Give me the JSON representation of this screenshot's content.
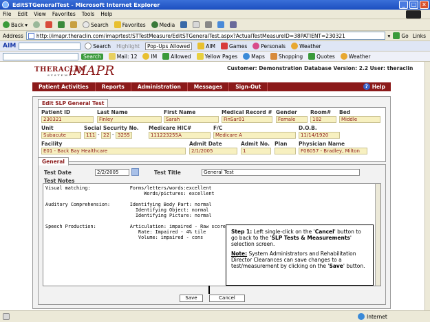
{
  "window": {
    "title": "EditSTGeneralTest - Microsoft Internet Explorer"
  },
  "menu": [
    "File",
    "Edit",
    "View",
    "Favorites",
    "Tools",
    "Help"
  ],
  "toolbar": {
    "back": "Back",
    "search": "Search",
    "favorites": "Favorites",
    "media": "Media",
    "links": "Links"
  },
  "address": {
    "label": "Address",
    "url": "http://imapr.theraclin.com/imaprtest/STTestMeasure/EditSTGeneralTest.aspx?ActualTestMeasureID=38PATIENT=230321",
    "go": "Go"
  },
  "aim": {
    "logo": "AIM",
    "search": "Search",
    "highlight": "Highlight",
    "popups": "Pop-Ups Allowed",
    "aim": "AIM",
    "games": "Games",
    "personals": "Personals",
    "weather": "Weather"
  },
  "gbar": {
    "search": "Search",
    "mail": "Mail: 12",
    "im": "IM",
    "allowed": "Allowed",
    "yellow": "Yellow Pages",
    "maps": "Maps",
    "shopping": "Shopping",
    "quotes": "Quotes",
    "weather": "Weather"
  },
  "app": {
    "logo_thera": "THERACLIN",
    "logo_sub": "SYSTEMS",
    "logo_imapr": "iMAPR",
    "customer_info": "Customer: Demonstration Database Version: 2.2 User: theraclin"
  },
  "nav": {
    "items": [
      "Patient Activities",
      "Reports",
      "Administration",
      "Messages",
      "Sign-Out"
    ],
    "help": "Help"
  },
  "form": {
    "tab": "Edit SLP General Test",
    "labels": {
      "patient_id": "Patient ID",
      "last_name": "Last Name",
      "first_name": "First Name",
      "medical_record": "Medical Record #",
      "gender": "Gender",
      "room": "Room#",
      "bed": "Bed",
      "unit": "Unit",
      "ssn": "Social Security No.",
      "medicare": "Medicare HIC#",
      "fc": "F/C",
      "dob": "D.O.B.",
      "facility": "Facility",
      "admit_date": "Admit Date",
      "admit_no": "Admit No.",
      "plan": "Plan",
      "physician": "Physician Name"
    },
    "values": {
      "patient_id": "230321",
      "last_name": "Finley",
      "first_name": "Sarah",
      "medical_record": "FinSar01",
      "gender": "Female",
      "room": "102",
      "bed": "Middle",
      "unit": "Subacute",
      "ssn1": "111",
      "ssn2": "22",
      "ssn3": "3255",
      "medicare": "111223255A",
      "fc": "Medicare A",
      "dob": "11/14/1920",
      "facility": "E01 - Back Bay Healthcare",
      "admit_date": "2/1/2005",
      "admit_no": "1",
      "plan": "",
      "physician": "F06057 - Bradley, Milton"
    }
  },
  "general": {
    "tab": "General",
    "test_date_label": "Test Date",
    "test_date": "2/2/2005",
    "test_title_label": "Test Title",
    "test_title": "General Test",
    "notes_label": "Test Notes",
    "notes": [
      "Visual matching:              Forms/letters/words:excellent",
      "                                   Words/pictures: excellent",
      "",
      "Auditory Comprehension:       Identifying Body Part: normal",
      "                                Identifying Object: normal",
      "                                Identifying Picture: normal",
      "",
      "Speech Production:            Articulation: impaired - Raw score = 8",
      "                                 Rate: Impaired - 4% tile",
      "                                 Volume: impaired - cons"
    ],
    "save": "Save",
    "cancel": "Cancel"
  },
  "callout": {
    "step_prefix": "Step 1:",
    "step_text_a": " Left single-click on the '",
    "step_cancel": "Cancel",
    "step_text_b": "' button to go back to the '",
    "step_screen": "SLP Tests & Measurements",
    "step_text_c": "' selection screen.",
    "note_prefix": "Note:",
    "note_text_a": " System Administrators and Rehabilitation Director Clearances can save changes to a test/measurement by clicking on the '",
    "note_save": "Save",
    "note_text_b": "' button."
  },
  "status": {
    "zone": "Internet"
  },
  "colors": {
    "brand": "#8b1a1a",
    "field_bg": "#f7f0c0",
    "xp_blue": "#1c4fc0"
  }
}
